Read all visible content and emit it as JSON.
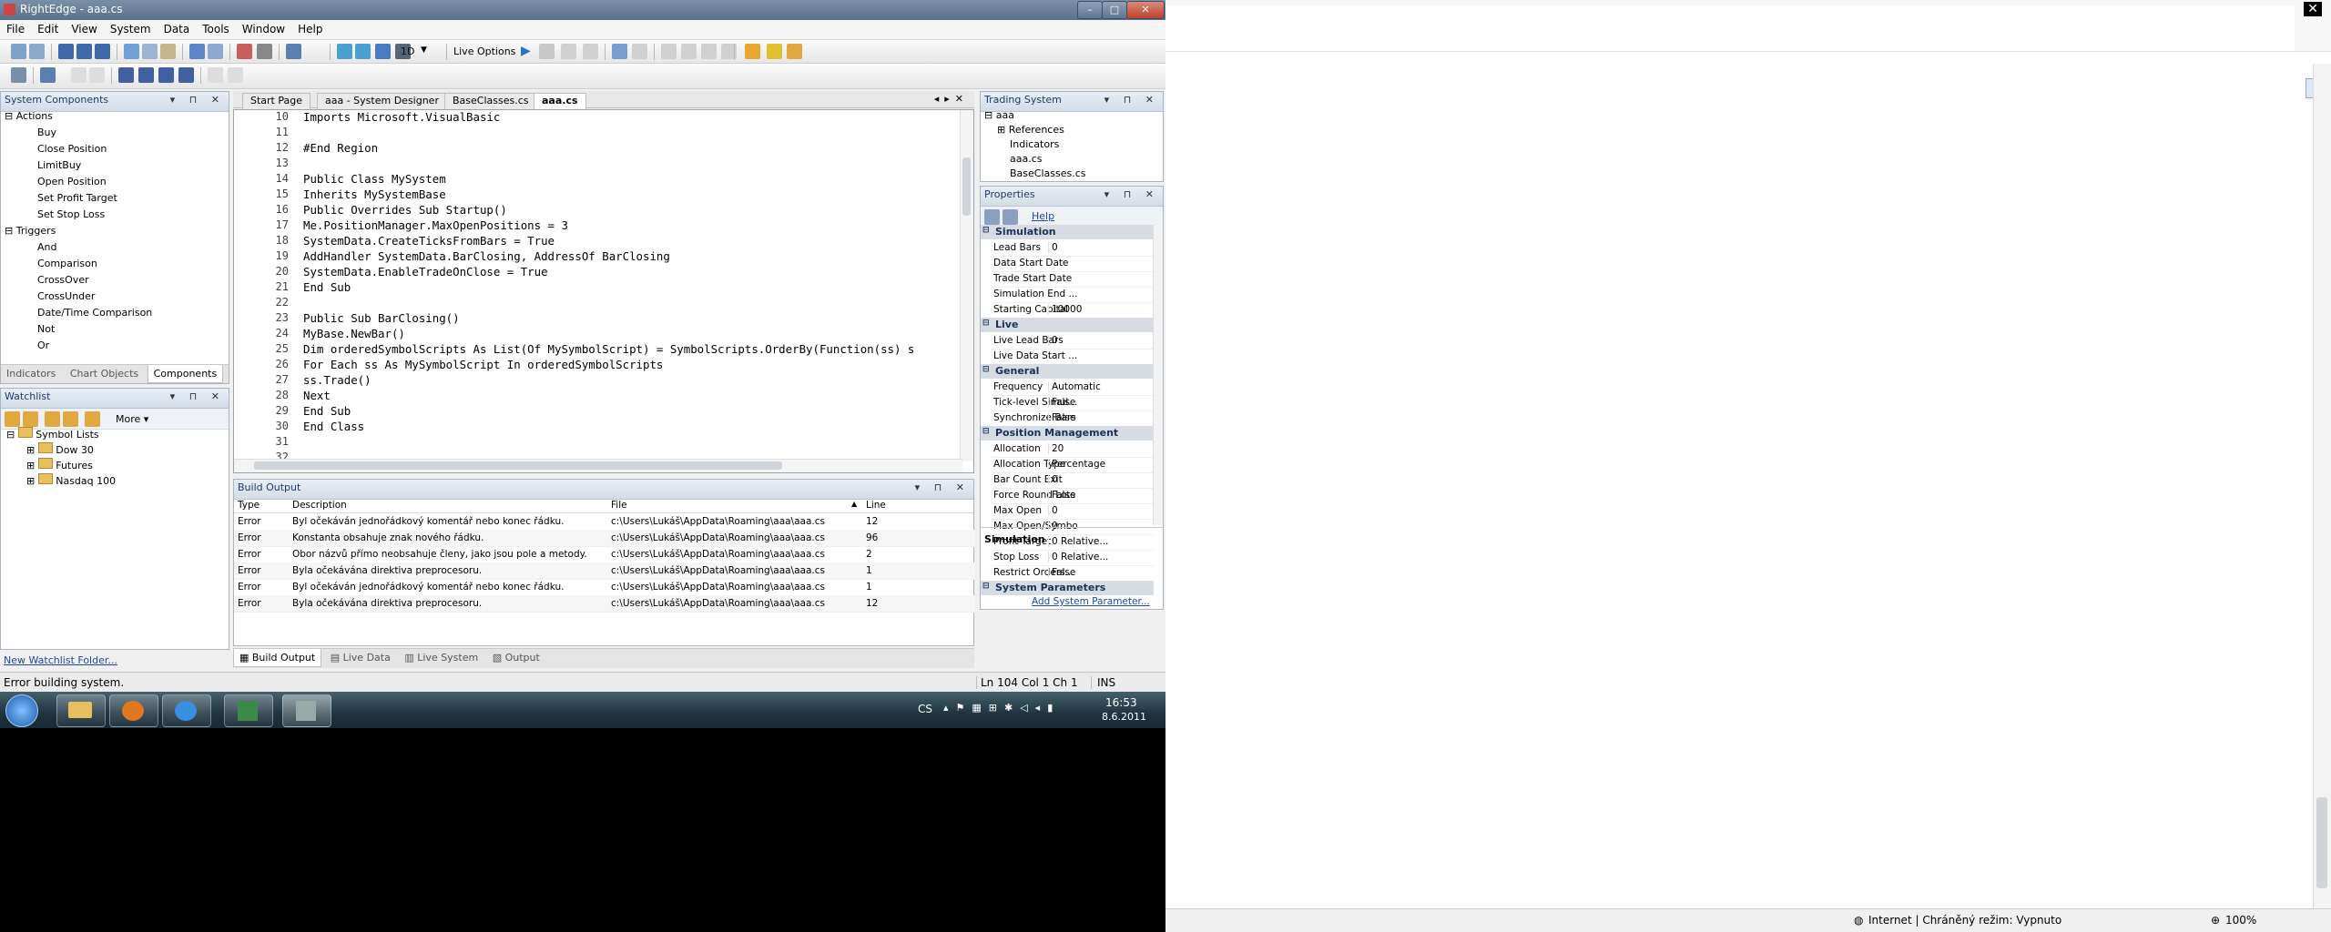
{
  "window": {
    "title": "RightEdge - aaa.cs",
    "min": "–",
    "max": "□",
    "close": "✕"
  },
  "menu": [
    "File",
    "Edit",
    "View",
    "System",
    "Data",
    "Tools",
    "Window",
    "Help"
  ],
  "toolbar": {
    "interval": "1D",
    "live_options": "Live Options"
  },
  "system_components": {
    "title": "System Components",
    "actions_label": "Actions",
    "actions": [
      "Buy",
      "Close Position",
      "LimitBuy",
      "Open Position",
      "Set Profit Target",
      "Set Stop Loss"
    ],
    "triggers_label": "Triggers",
    "triggers": [
      "And",
      "Comparison",
      "CrossOver",
      "CrossUnder",
      "Date/Time Comparison",
      "Not",
      "Or"
    ],
    "tabs": [
      "Indicators",
      "Chart Objects",
      "Components"
    ]
  },
  "watchlist": {
    "title": "Watchlist",
    "more": "More",
    "root": "Symbol Lists",
    "items": [
      "Dow 30",
      "Futures",
      "Nasdaq 100"
    ],
    "new_folder": "New Watchlist Folder..."
  },
  "doc_tabs": [
    "Start Page",
    "aaa - System Designer",
    "BaseClasses.cs",
    "aaa.cs"
  ],
  "editor": {
    "lines": [
      {
        "n": "10",
        "code": "Imports Microsoft.VisualBasic"
      },
      {
        "n": "11",
        "code": ""
      },
      {
        "n": "12",
        "code": "#End Region"
      },
      {
        "n": "13",
        "code": ""
      },
      {
        "n": "14",
        "code": "Public Class MySystem"
      },
      {
        "n": "15",
        "code": "Inherits MySystemBase"
      },
      {
        "n": "16",
        "code": "Public Overrides Sub Startup()"
      },
      {
        "n": "17",
        "code": "Me.PositionManager.MaxOpenPositions = 3"
      },
      {
        "n": "18",
        "code": "SystemData.CreateTicksFromBars = True"
      },
      {
        "n": "19",
        "code": "AddHandler SystemData.BarClosing, AddressOf BarClosing"
      },
      {
        "n": "20",
        "code": "SystemData.EnableTradeOnClose = True"
      },
      {
        "n": "21",
        "code": "End Sub"
      },
      {
        "n": "22",
        "code": ""
      },
      {
        "n": "23",
        "code": "Public Sub BarClosing()"
      },
      {
        "n": "24",
        "code": "MyBase.NewBar()"
      },
      {
        "n": "25",
        "code": "Dim orderedSymbolScripts As List(Of MySymbolScript) = SymbolScripts.OrderBy(Function(ss) s"
      },
      {
        "n": "26",
        "code": "For Each ss As MySymbolScript In orderedSymbolScripts"
      },
      {
        "n": "27",
        "code": "ss.Trade()"
      },
      {
        "n": "28",
        "code": "Next"
      },
      {
        "n": "29",
        "code": "End Sub"
      },
      {
        "n": "30",
        "code": "End Class"
      },
      {
        "n": "31",
        "code": ""
      },
      {
        "n": "32",
        "code": ""
      }
    ]
  },
  "build_output": {
    "title": "Build Output",
    "columns": [
      "Type",
      "Description",
      "File",
      "Line"
    ],
    "rows": [
      {
        "type": "Error",
        "desc": "Byl očekáván jednořádkový komentář nebo konec řádku.",
        "file": "c:\\Users\\Lukáš\\AppData\\Roaming\\aaa\\aaa.cs",
        "line": "12"
      },
      {
        "type": "Error",
        "desc": "Konstanta obsahuje znak nového řádku.",
        "file": "c:\\Users\\Lukáš\\AppData\\Roaming\\aaa\\aaa.cs",
        "line": "96"
      },
      {
        "type": "Error",
        "desc": "Obor názvů přímo neobsahuje členy, jako jsou pole a metody.",
        "file": "c:\\Users\\Lukáš\\AppData\\Roaming\\aaa\\aaa.cs",
        "line": "2"
      },
      {
        "type": "Error",
        "desc": "Byla očekávána direktiva preprocesoru.",
        "file": "c:\\Users\\Lukáš\\AppData\\Roaming\\aaa\\aaa.cs",
        "line": "1"
      },
      {
        "type": "Error",
        "desc": "Byl očekáván jednořádkový komentář nebo konec řádku.",
        "file": "c:\\Users\\Lukáš\\AppData\\Roaming\\aaa\\aaa.cs",
        "line": "1"
      },
      {
        "type": "Error",
        "desc": "Byla očekávána direktiva preprocesoru.",
        "file": "c:\\Users\\Lukáš\\AppData\\Roaming\\aaa\\aaa.cs",
        "line": "12"
      }
    ],
    "tabs": [
      "Build Output",
      "Live Data",
      "Live System",
      "Output"
    ]
  },
  "trading_system": {
    "title": "Trading System",
    "root": "aaa",
    "items": [
      "References",
      "Indicators",
      "aaa.cs",
      "BaseClasses.cs"
    ]
  },
  "properties": {
    "title": "Properties",
    "help": "Help",
    "categories": [
      {
        "name": "Simulation",
        "props": [
          {
            "k": "Lead Bars",
            "v": "0"
          },
          {
            "k": "Data Start Date",
            "v": ""
          },
          {
            "k": "Trade Start Date",
            "v": ""
          },
          {
            "k": "Simulation End ...",
            "v": ""
          },
          {
            "k": "Starting Capital",
            "v": "10000"
          }
        ]
      },
      {
        "name": "Live",
        "props": [
          {
            "k": "Live Lead Bars",
            "v": "0"
          },
          {
            "k": "Live Data Start ...",
            "v": ""
          }
        ]
      },
      {
        "name": "General",
        "props": [
          {
            "k": "Frequency",
            "v": "Automatic"
          },
          {
            "k": "Tick-level Simul...",
            "v": "False"
          },
          {
            "k": "Synchronize Bars",
            "v": "False"
          }
        ]
      },
      {
        "name": "Position Management",
        "props": [
          {
            "k": "Allocation",
            "v": "20"
          },
          {
            "k": "Allocation Type",
            "v": "Percentage"
          },
          {
            "k": "Bar Count Exit",
            "v": "0"
          },
          {
            "k": "Force Round Lots",
            "v": "False"
          },
          {
            "k": "Max Open",
            "v": "0"
          },
          {
            "k": "Max Open/Symbol",
            "v": "0"
          },
          {
            "k": "Profit Target",
            "v": "0 Relative..."
          },
          {
            "k": "Stop Loss",
            "v": "0 Relative..."
          },
          {
            "k": "Restrict Orders...",
            "v": "False"
          }
        ]
      },
      {
        "name": "System Parameters",
        "props": []
      }
    ],
    "add_param": "Add System Parameter...",
    "description_title": "Simulation"
  },
  "status": {
    "message": "Error building system.",
    "position": "Ln 104  Col 1  Ch 1",
    "mode": "INS"
  },
  "taskbar": {
    "lang": "CS",
    "time": "16:53",
    "date": "8.6.2011"
  },
  "browser": {
    "close": "✕",
    "status": "Internet | Chráněný režim: Vypnuto",
    "zoom": "100%"
  }
}
